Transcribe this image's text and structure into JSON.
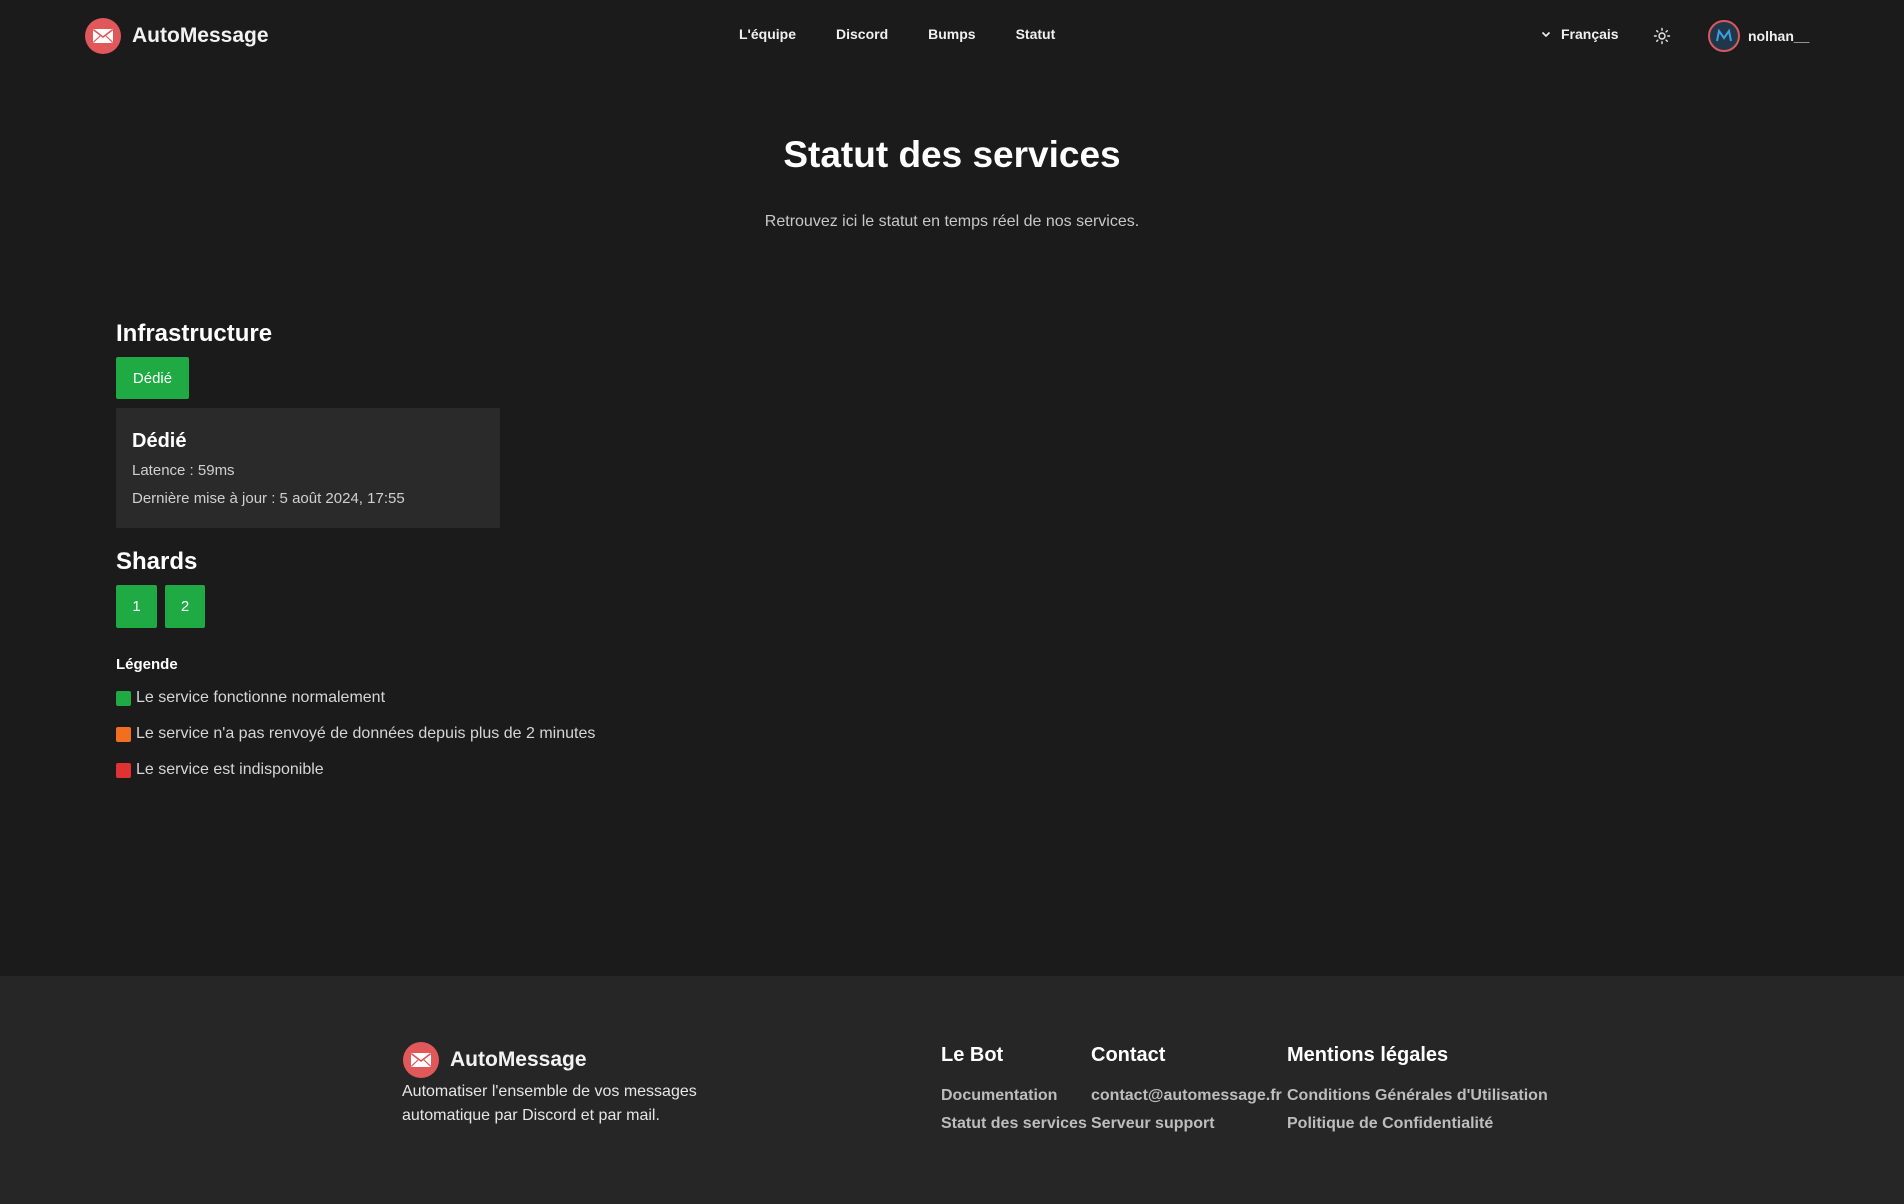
{
  "header": {
    "brand": "AutoMessage",
    "nav": [
      "L'équipe",
      "Discord",
      "Bumps",
      "Statut"
    ],
    "language": "Français",
    "username": "nolhan__"
  },
  "hero": {
    "title": "Statut des services",
    "subtitle": "Retrouvez ici le statut en temps réel de nos services."
  },
  "infrastructure": {
    "title": "Infrastructure",
    "servers": [
      {
        "label": "Dédié",
        "status": "ok"
      }
    ],
    "card": {
      "title": "Dédié",
      "latency": "Latence : 59ms",
      "updated": "Dernière mise à jour : 5 août 2024, 17:55"
    }
  },
  "shards": {
    "title": "Shards",
    "items": [
      {
        "label": "1",
        "status": "ok"
      },
      {
        "label": "2",
        "status": "ok"
      }
    ]
  },
  "legend": {
    "title": "Légende",
    "items": [
      {
        "color": "#1faa44",
        "text": "Le service fonctionne normalement"
      },
      {
        "color": "#f07020",
        "text": "Le service n'a pas renvoyé de données depuis plus de 2 minutes"
      },
      {
        "color": "#e03232",
        "text": "Le service est indisponible"
      }
    ]
  },
  "footer": {
    "brand": "AutoMessage",
    "description": "Automatiser l'ensemble de vos messages automatique par Discord et par mail.",
    "columns": [
      {
        "title": "Le Bot",
        "links": [
          "Documentation",
          "Statut des services"
        ]
      },
      {
        "title": "Contact",
        "links": [
          "contact@automessage.fr",
          "Serveur support"
        ]
      },
      {
        "title": "Mentions légales",
        "links": [
          "Conditions Générales d'Utilisation",
          "Politique de Confidentialité"
        ]
      }
    ]
  },
  "colors": {
    "accent_green": "#1faa44",
    "logo_red": "#e0585a",
    "background": "#1b1b1b",
    "footer_bg": "#262626"
  }
}
